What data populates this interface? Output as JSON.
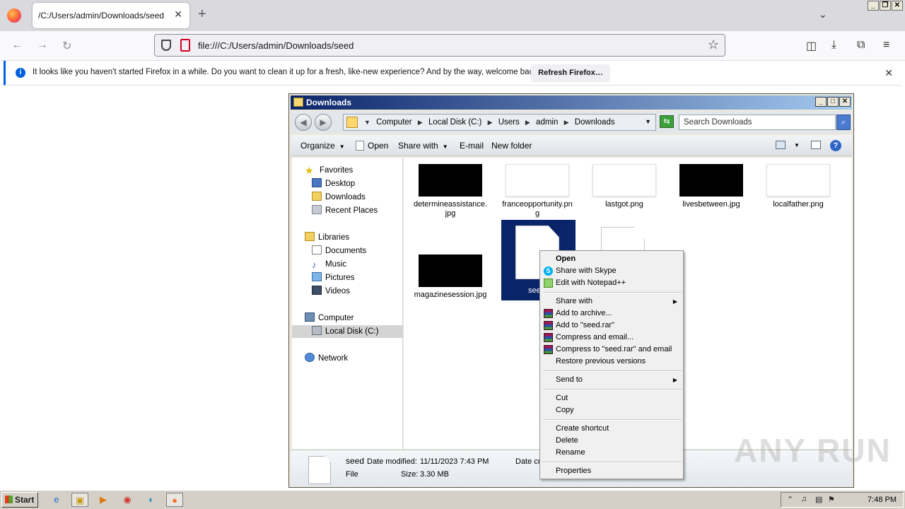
{
  "browser": {
    "tab_title": "/C:/Users/admin/Downloads/seed",
    "url": "file:///C:/Users/admin/Downloads/seed",
    "notification_text": "It looks like you haven't started Firefox in a while. Do you want to clean it up for a fresh, like-new experience? And by the way, welcome back!",
    "notification_button": "Refresh Firefox…",
    "accent_color": "#0060df"
  },
  "explorer": {
    "window_title": "Downloads",
    "breadcrumb": [
      "Computer",
      "Local Disk (C:)",
      "Users",
      "admin",
      "Downloads"
    ],
    "search_placeholder": "Search Downloads",
    "toolbar": {
      "organize": "Organize",
      "open": "Open",
      "share_with": "Share with",
      "email": "E-mail",
      "new_folder": "New folder"
    },
    "nav": {
      "favorites": "Favorites",
      "desktop": "Desktop",
      "downloads": "Downloads",
      "recent_places": "Recent Places",
      "libraries": "Libraries",
      "documents": "Documents",
      "music": "Music",
      "pictures": "Pictures",
      "videos": "Videos",
      "computer": "Computer",
      "local_disk": "Local Disk (C:)",
      "network": "Network"
    },
    "files": [
      {
        "name": "determineassistance.jpg",
        "thumb": "dark"
      },
      {
        "name": "franceopportunity.png",
        "thumb": "light"
      },
      {
        "name": "lastgot.png",
        "thumb": "light"
      },
      {
        "name": "livesbetween.jpg",
        "thumb": "dark"
      },
      {
        "name": "localfather.png",
        "thumb": "light"
      },
      {
        "name": "magazinesession.jpg",
        "thumb": "dark"
      },
      {
        "name": "seed",
        "thumb": "doc",
        "selected": true
      }
    ],
    "details": {
      "name": "seed",
      "type": "File",
      "date_modified_label": "Date modified:",
      "date_modified": "11/11/2023 7:43 PM",
      "size_label": "Size:",
      "size": "3.30 MB",
      "date_created_partial": "Date cr"
    },
    "selection_color": "#0a246a"
  },
  "context_menu": {
    "open": "Open",
    "share_skype": "Share with Skype",
    "edit_notepad": "Edit with Notepad++",
    "share_with": "Share with",
    "add_archive": "Add to archive...",
    "add_seed_rar": "Add to \"seed.rar\"",
    "compress_email": "Compress and email...",
    "compress_seed_email": "Compress to \"seed.rar\" and email",
    "restore": "Restore previous versions",
    "send_to": "Send to",
    "cut": "Cut",
    "copy": "Copy",
    "create_shortcut": "Create shortcut",
    "delete": "Delete",
    "rename": "Rename",
    "properties": "Properties"
  },
  "watermark": "ANY RUN",
  "taskbar": {
    "start": "Start",
    "time": "7:48 PM"
  }
}
